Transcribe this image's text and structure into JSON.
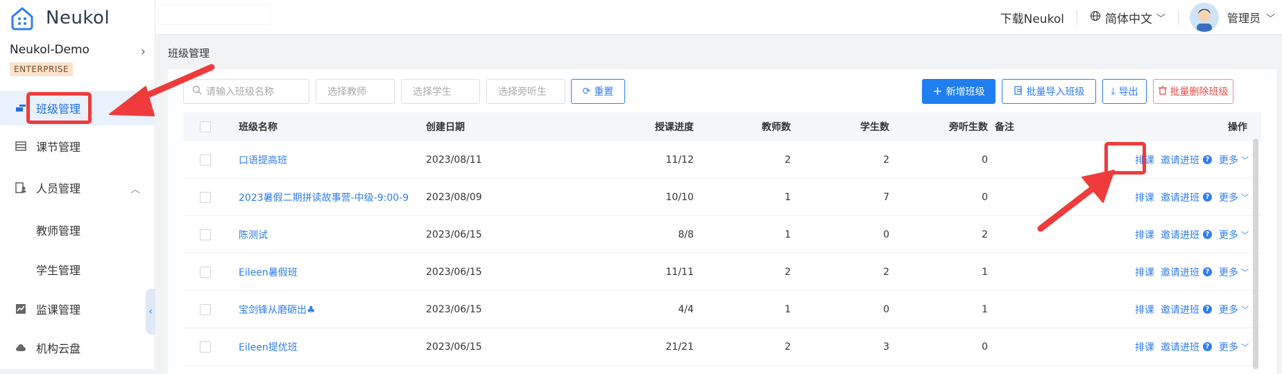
{
  "brand": {
    "name": "Neukol"
  },
  "org": {
    "name": "Neukol-Demo",
    "plan": "ENTERPRISE"
  },
  "nav": {
    "class_mgmt": "班级管理",
    "lesson_mgmt": "课节管理",
    "people_mgmt": "人员管理",
    "teacher_mgmt": "教师管理",
    "student_mgmt": "学生管理",
    "supervise_mgmt": "监课管理",
    "cloud": "机构云盘"
  },
  "header": {
    "download": "下载Neukol",
    "language": "简体中文",
    "user": "管理员"
  },
  "breadcrumb": "班级管理",
  "filters": {
    "class_name_placeholder": "请输入班级名称",
    "teacher_placeholder": "选择教师",
    "student_placeholder": "选择学生",
    "auditor_placeholder": "选择旁听生",
    "reset_label": "重置"
  },
  "actions": {
    "add_class": "新增班级",
    "batch_import": "批量导入班级",
    "export": "导出",
    "batch_delete": "批量删除班级"
  },
  "table": {
    "headers": {
      "name": "班级名称",
      "date": "创建日期",
      "progress": "授课进度",
      "teachers": "教师数",
      "students": "学生数",
      "auditors": "旁听生数",
      "note": "备注",
      "ops": "操作"
    },
    "op_labels": {
      "schedule": "排课",
      "invite": "邀请进班",
      "more": "更多"
    },
    "rows": [
      {
        "name": "口语提高班",
        "date": "2023/08/11",
        "progress": "11/12",
        "teachers": "2",
        "students": "2",
        "auditors": "0"
      },
      {
        "name": "2023暑假二期拼读故事营-中级-9:00-9",
        "date": "2023/08/09",
        "progress": "10/10",
        "teachers": "1",
        "students": "7",
        "auditors": "0"
      },
      {
        "name": "陈测试",
        "date": "2023/06/15",
        "progress": "8/8",
        "teachers": "1",
        "students": "0",
        "auditors": "2"
      },
      {
        "name": "Eileen暑假班",
        "date": "2023/06/15",
        "progress": "11/11",
        "teachers": "2",
        "students": "2",
        "auditors": "1"
      },
      {
        "name": "宝剑锋从磨砺出♣",
        "date": "2023/06/15",
        "progress": "4/4",
        "teachers": "1",
        "students": "0",
        "auditors": "1"
      },
      {
        "name": "Eileen提优班",
        "date": "2023/06/15",
        "progress": "21/21",
        "teachers": "2",
        "students": "3",
        "auditors": "0"
      }
    ]
  },
  "colors": {
    "accent": "#1f7ef0",
    "danger": "#e54d4d",
    "annotation": "#ef3b3b"
  }
}
